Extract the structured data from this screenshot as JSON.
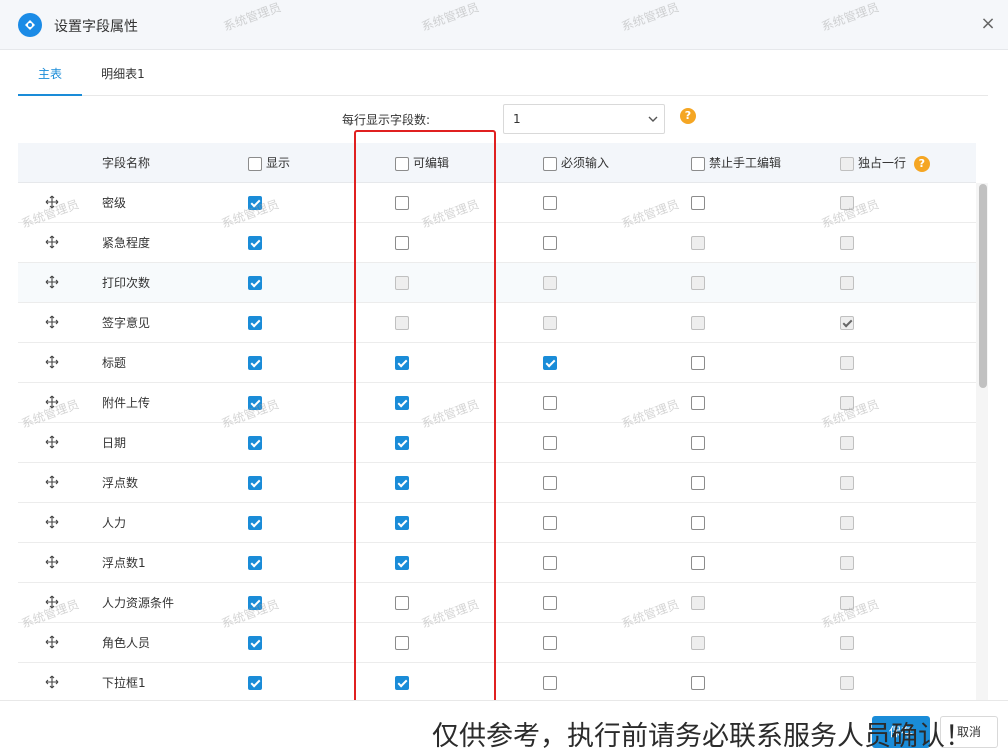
{
  "header": {
    "title": "设置字段属性",
    "close": "×"
  },
  "tabs": [
    {
      "label": "主表",
      "active": true
    },
    {
      "label": "明细表1",
      "active": false
    }
  ],
  "per_row": {
    "label": "每行显示字段数:",
    "value": "1",
    "help": "?"
  },
  "columns": {
    "name": "字段名称",
    "show": "显示",
    "editable": "可编辑",
    "required": "必须输入",
    "no_manual_edit": "禁止手工编辑",
    "exclusive_row": "独占一行",
    "help": "?"
  },
  "rows": [
    {
      "name": "密级",
      "show": "checked",
      "editable": "unchecked",
      "required": "unchecked",
      "no_manual": "unchecked",
      "exclusive": "disabled"
    },
    {
      "name": "紧急程度",
      "show": "checked",
      "editable": "unchecked",
      "required": "unchecked",
      "no_manual": "disabled",
      "exclusive": "disabled"
    },
    {
      "name": "打印次数",
      "show": "checked",
      "editable": "disabled",
      "required": "disabled",
      "no_manual": "disabled",
      "exclusive": "disabled"
    },
    {
      "name": "签字意见",
      "show": "checked",
      "editable": "disabled",
      "required": "disabled",
      "no_manual": "disabled",
      "exclusive": "disabled-checked"
    },
    {
      "name": "标题",
      "show": "checked",
      "editable": "checked",
      "required": "checked",
      "no_manual": "unchecked",
      "exclusive": "disabled"
    },
    {
      "name": "附件上传",
      "show": "checked",
      "editable": "checked",
      "required": "unchecked",
      "no_manual": "unchecked",
      "exclusive": "disabled"
    },
    {
      "name": "日期",
      "show": "checked",
      "editable": "checked",
      "required": "unchecked",
      "no_manual": "unchecked",
      "exclusive": "disabled"
    },
    {
      "name": "浮点数",
      "show": "checked",
      "editable": "checked",
      "required": "unchecked",
      "no_manual": "unchecked",
      "exclusive": "disabled"
    },
    {
      "name": "人力",
      "show": "checked",
      "editable": "checked",
      "required": "unchecked",
      "no_manual": "unchecked",
      "exclusive": "disabled"
    },
    {
      "name": "浮点数1",
      "show": "checked",
      "editable": "checked",
      "required": "unchecked",
      "no_manual": "unchecked",
      "exclusive": "disabled"
    },
    {
      "name": "人力资源条件",
      "show": "checked",
      "editable": "unchecked",
      "required": "unchecked",
      "no_manual": "disabled",
      "exclusive": "disabled"
    },
    {
      "name": "角色人员",
      "show": "checked",
      "editable": "unchecked",
      "required": "unchecked",
      "no_manual": "disabled",
      "exclusive": "disabled"
    },
    {
      "name": "下拉框1",
      "show": "checked",
      "editable": "checked",
      "required": "unchecked",
      "no_manual": "unchecked",
      "exclusive": "disabled"
    }
  ],
  "watermark": "系统管理员",
  "footer": {
    "notice": "仅供参考，执行前请务必联系服务人员确认！",
    "save": "保存",
    "cancel": "取消"
  },
  "colors": {
    "accent": "#1a8cd8",
    "highlight": "#e02020",
    "help": "#f5a623"
  }
}
